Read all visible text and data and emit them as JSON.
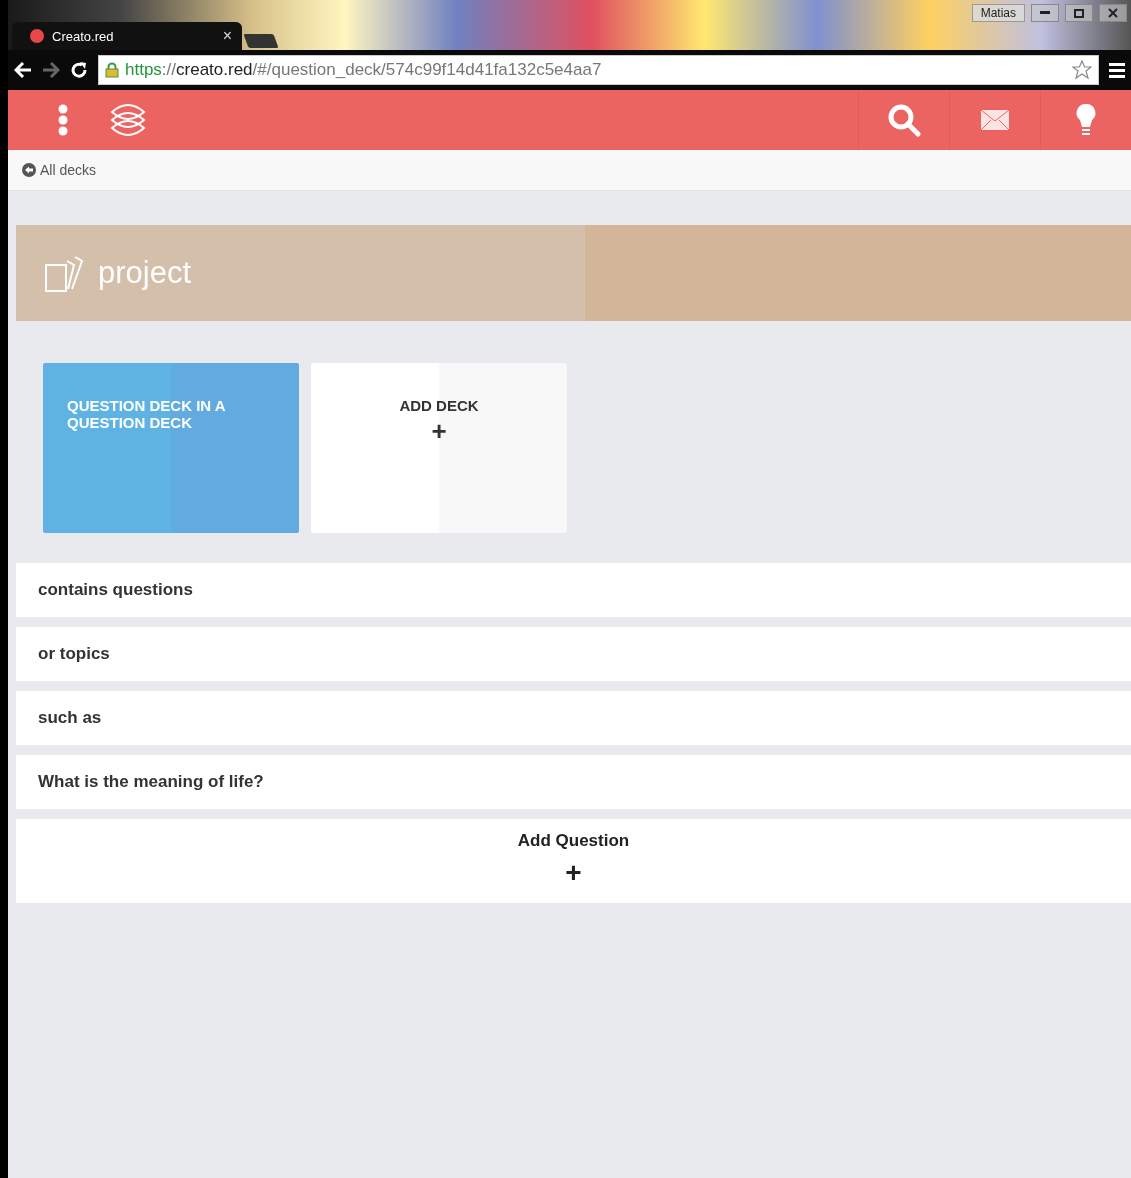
{
  "browser": {
    "user": "Matias",
    "tab": {
      "title": "Creato.red",
      "close": "×"
    },
    "url": {
      "scheme": "https",
      "separator": "://",
      "host": "creato.red",
      "path": "/#/question_deck/574c99f14d41fa132c5e4aa7"
    }
  },
  "breadcrumb": {
    "label": "All decks"
  },
  "deck": {
    "title": "project"
  },
  "subdecks": [
    {
      "kind": "deck",
      "title": "QUESTION DECK IN A QUESTION DECK"
    },
    {
      "kind": "add",
      "title": "ADD DECK",
      "symbol": "+"
    }
  ],
  "questions": [
    {
      "text": "contains questions"
    },
    {
      "text": "or topics"
    },
    {
      "text": "such as"
    },
    {
      "text": "What is the meaning of life?"
    }
  ],
  "add_question": {
    "label": "Add Question",
    "symbol": "+"
  }
}
